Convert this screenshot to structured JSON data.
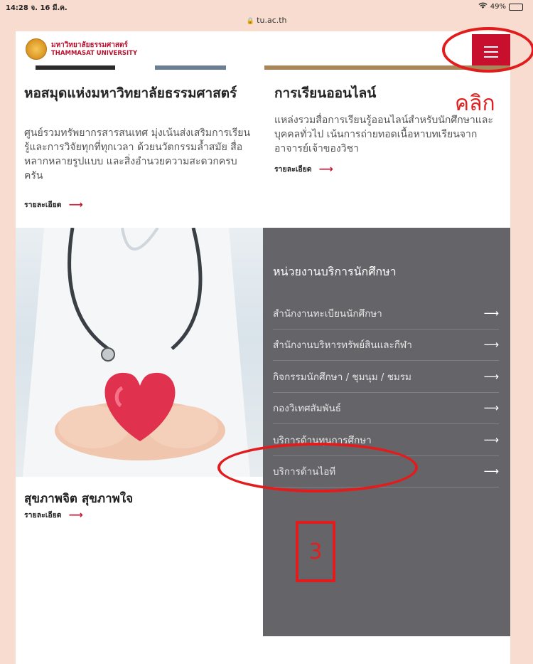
{
  "statusbar": {
    "time": "14:28  จ. 16 มี.ค.",
    "battery": "49%",
    "battery_level": 0.49
  },
  "browser": {
    "url": "tu.ac.th"
  },
  "header": {
    "logo_thai": "มหาวิทยาลัยธรรมศาสตร์",
    "logo_english": "THAMMASAT UNIVERSITY",
    "menu_icon": "hamburger-menu-icon"
  },
  "library": {
    "title": "หอสมุดแห่งมหาวิทยาลัยธรรมศาสตร์",
    "description": "ศูนย์รวมทรัพยากรสารสนเทศ มุ่งเน้นส่งเสริมการเรียนรู้และการวิจัยทุกที่ทุกเวลา ด้วยนวัตกรรมล้ำสมัย สื่อหลากหลายรูปแบบ และสิ่งอำนวยความสะดวกครบครัน",
    "more_label": "รายละเอียด"
  },
  "online": {
    "title": "การเรียนออนไลน์",
    "description": "แหล่งรวมสื่อการเรียนรู้ออนไลน์สำหรับนักศึกษาและบุคคลทั่วไป เน้นการถ่ายทอดเนื้อหาบทเรียนจากอาจารย์เจ้าของวิชา",
    "more_label": "รายละเอียด"
  },
  "health": {
    "title": "สุขภาพจิต สุขภาพใจ",
    "more_label": "รายละเอียด"
  },
  "services": {
    "title": "หน่วยงานบริการนักศึกษา",
    "items": [
      "สำนักงานทะเบียนนักศึกษา",
      "สำนักงานบริหารทรัพย์สินและกีฬา",
      "กิจกรรมนักศึกษา / ชุมนุม / ชมรม",
      "กองวิเทศสัมพันธ์",
      "บริการด้านทุนการศึกษา",
      "บริการด้านไอที"
    ]
  },
  "annotations": {
    "click_label": "คลิก",
    "step_number": "3",
    "color": "#e21c1c"
  },
  "colors": {
    "brand_red": "#c8102e",
    "panel_gray": "#656569",
    "page_bg": "#f7dccf"
  }
}
